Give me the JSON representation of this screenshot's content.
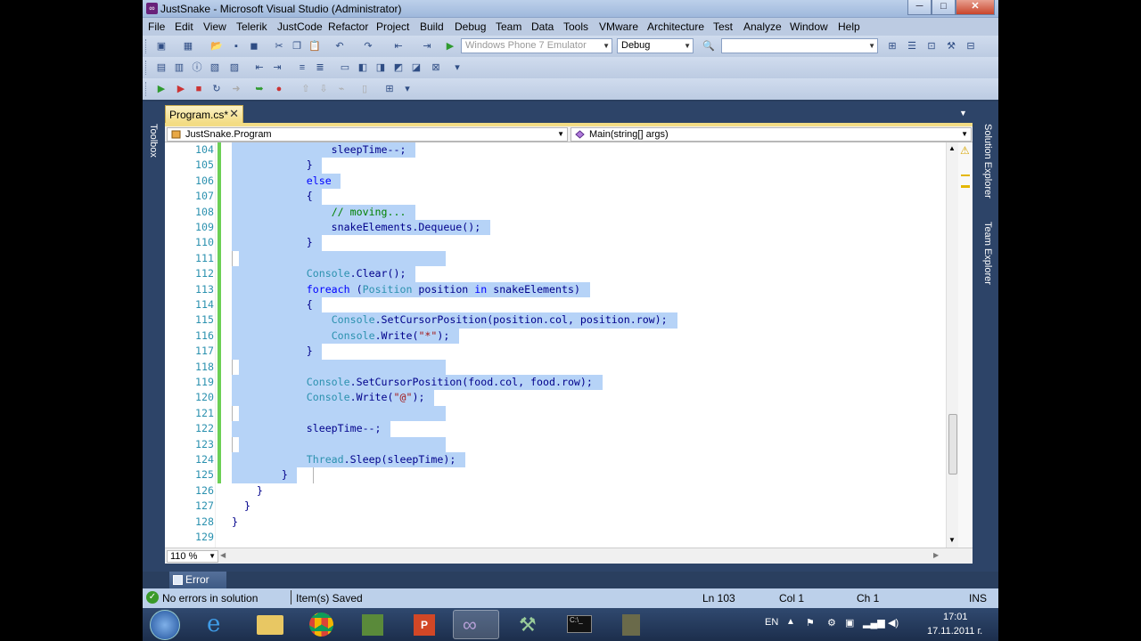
{
  "window": {
    "title": "JustSnake - Microsoft Visual Studio (Administrator)",
    "min": "─",
    "max": "□",
    "close": "✕"
  },
  "menu": [
    "File",
    "Edit",
    "View",
    "Telerik",
    "JustCode",
    "Refactor",
    "Project",
    "Build",
    "Debug",
    "Team",
    "Data",
    "Tools",
    "VMware",
    "Architecture",
    "Test",
    "Analyze",
    "Window",
    "Help"
  ],
  "toolbar": {
    "target": "Windows Phone 7 Emulator",
    "config": "Debug",
    "find": ""
  },
  "document": {
    "tab": "Program.cs*",
    "tab_close": "✕",
    "type_dropdown": "JustSnake.Program",
    "member_dropdown": "Main(string[] args)",
    "zoom": "110 %"
  },
  "code": [
    {
      "n": "104",
      "t": [
        [
          "                sleepTime--;",
          ""
        ]
      ]
    },
    {
      "n": "105",
      "t": [
        [
          "            }",
          ""
        ]
      ]
    },
    {
      "n": "106",
      "t": [
        [
          "            ",
          ""
        ],
        [
          "else",
          "kw"
        ]
      ]
    },
    {
      "n": "107",
      "t": [
        [
          "            {",
          ""
        ]
      ]
    },
    {
      "n": "108",
      "t": [
        [
          "                ",
          ""
        ],
        [
          "// moving...",
          "cm"
        ]
      ]
    },
    {
      "n": "109",
      "t": [
        [
          "                snakeElements.Dequeue();",
          ""
        ]
      ]
    },
    {
      "n": "110",
      "t": [
        [
          "            }",
          ""
        ]
      ]
    },
    {
      "n": "111",
      "t": [
        [
          "",
          ""
        ]
      ]
    },
    {
      "n": "112",
      "t": [
        [
          "            ",
          ""
        ],
        [
          "Console",
          "cls"
        ],
        [
          ".Clear();",
          ""
        ]
      ]
    },
    {
      "n": "113",
      "t": [
        [
          "            ",
          ""
        ],
        [
          "foreach",
          "kw"
        ],
        [
          " (",
          ""
        ],
        [
          "Position",
          "cls"
        ],
        [
          " position ",
          ""
        ],
        [
          "in",
          "kw"
        ],
        [
          " snakeElements)",
          ""
        ]
      ]
    },
    {
      "n": "114",
      "t": [
        [
          "            {",
          ""
        ]
      ]
    },
    {
      "n": "115",
      "t": [
        [
          "                ",
          ""
        ],
        [
          "Console",
          "cls"
        ],
        [
          ".SetCursorPosition(position.col, position.row);",
          ""
        ]
      ]
    },
    {
      "n": "116",
      "t": [
        [
          "                ",
          ""
        ],
        [
          "Console",
          "cls"
        ],
        [
          ".Write(",
          ""
        ],
        [
          "\"*\"",
          "str"
        ],
        [
          ");",
          ""
        ]
      ]
    },
    {
      "n": "117",
      "t": [
        [
          "            }",
          ""
        ]
      ]
    },
    {
      "n": "118",
      "t": [
        [
          "",
          ""
        ]
      ]
    },
    {
      "n": "119",
      "t": [
        [
          "            ",
          ""
        ],
        [
          "Console",
          "cls"
        ],
        [
          ".SetCursorPosition(food.col, food.row);",
          ""
        ]
      ]
    },
    {
      "n": "120",
      "t": [
        [
          "            ",
          ""
        ],
        [
          "Console",
          "cls"
        ],
        [
          ".Write(",
          ""
        ],
        [
          "\"@\"",
          "str"
        ],
        [
          ");",
          ""
        ]
      ]
    },
    {
      "n": "121",
      "t": [
        [
          "",
          ""
        ]
      ]
    },
    {
      "n": "122",
      "t": [
        [
          "            sleepTime--;",
          ""
        ]
      ]
    },
    {
      "n": "123",
      "t": [
        [
          "",
          ""
        ]
      ]
    },
    {
      "n": "124",
      "t": [
        [
          "            ",
          ""
        ],
        [
          "Thread",
          "cls"
        ],
        [
          ".Sleep(sleepTime);",
          ""
        ]
      ]
    },
    {
      "n": "125",
      "t": [
        [
          "        }",
          ""
        ]
      ]
    },
    {
      "n": "126",
      "t": [
        [
          "    }",
          ""
        ]
      ]
    },
    {
      "n": "127",
      "t": [
        [
          "  }",
          ""
        ]
      ]
    },
    {
      "n": "128",
      "t": [
        [
          "}",
          ""
        ]
      ]
    },
    {
      "n": "129",
      "t": [
        [
          "",
          ""
        ]
      ]
    }
  ],
  "panels": {
    "toolbox": "Toolbox",
    "solution_explorer": "Solution Explorer",
    "team_explorer": "Team Explorer",
    "error_list": "Error List"
  },
  "status": {
    "errors": "No errors in solution",
    "message": "Item(s) Saved",
    "ln": "Ln 103",
    "col": "Col 1",
    "ch": "Ch 1",
    "mode": "INS"
  },
  "tray": {
    "lang": "EN",
    "time": "17:01",
    "date": "17.11.2011 г."
  }
}
